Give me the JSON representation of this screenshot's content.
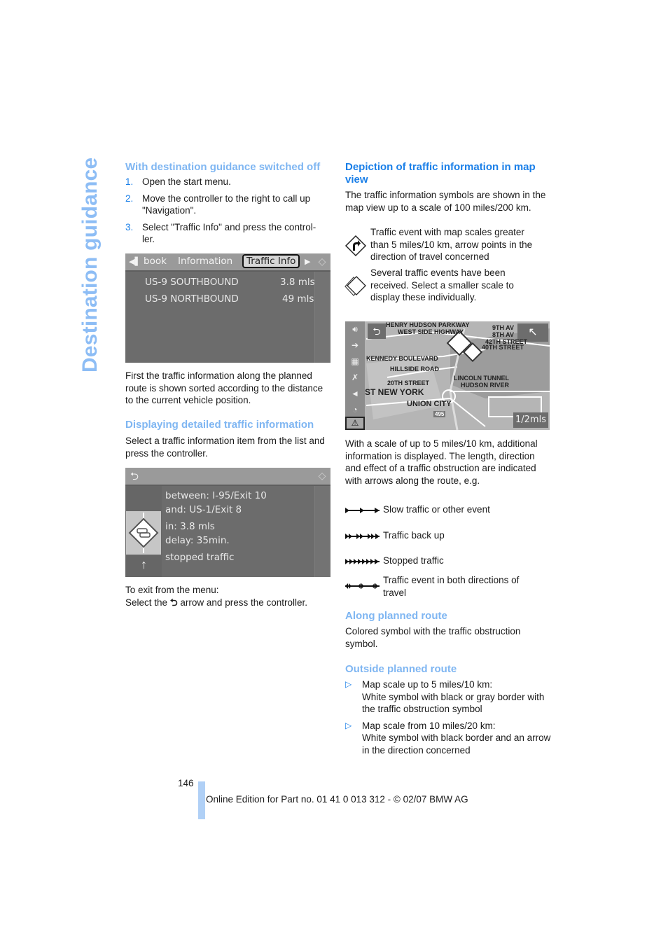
{
  "side_title": "Destination guidance",
  "left_column": {
    "section1": {
      "heading": "With destination guidance switched off",
      "steps": [
        {
          "num": "1.",
          "text": "Open the start menu."
        },
        {
          "num": "2.",
          "text": "Move the controller to the right to call up \"Navigation\"."
        },
        {
          "num": "3.",
          "text": "Select \"Traffic Info\" and press the control-ler."
        }
      ]
    },
    "screen1": {
      "tabs": [
        "book",
        "Information",
        "Traffic Info"
      ],
      "active_tab": "Traffic Info",
      "rows": [
        {
          "road": "US-9 SOUTHBOUND",
          "distance": "3.8 mls"
        },
        {
          "road": "US-9 NORTHBOUND",
          "distance": "49 mls"
        }
      ]
    },
    "para1": "First the traffic information along the planned route is shown sorted according to the distance to the current vehicle position.",
    "section2": {
      "heading": "Displaying detailed traffic information",
      "text": "Select a traffic information item from the list and press the controller."
    },
    "screen2": {
      "lines": [
        "between: I-95/Exit 10",
        "and: US-1/Exit 8",
        "in: 3.8 mls",
        "delay: 35min.",
        "stopped traffic"
      ]
    },
    "exit_text_1": "To exit from the menu:",
    "exit_text_2a": "Select the",
    "exit_text_2b": "arrow and press the controller."
  },
  "right_column": {
    "heading": "Depiction of traffic information in map view",
    "intro": "The traffic information symbols are shown in the map view up to a scale of 100 miles/200 km.",
    "symbols": [
      {
        "icon": "diamond-arrow-icon",
        "text": "Traffic event with map scales greater than 5 miles/10 km, arrow points in the direction of travel concerned"
      },
      {
        "icon": "stacked-diamond-icon",
        "text": "Several traffic events have been received. Select a smaller scale to display these individually."
      }
    ],
    "map": {
      "labels": [
        "HENRY HUDSON PARKWAY",
        "WEST SIDE HIGHWAY",
        "9TH AV",
        "8TH AV",
        "42TH STREET",
        "40TH STREET",
        "KENNEDY BOULEVARD",
        "HILLSIDE ROAD",
        "20TH STREET",
        "LINCOLN TUNNEL",
        "HUDSON RIVER",
        "ST NEW YORK",
        "UNION CITY",
        "495"
      ],
      "scale": "1/2mls"
    },
    "para2": "With a scale of up to 5 miles/10 km, additional information is displayed. The length, direction and effect of a traffic obstruction are indicated with arrows along the route, e.g.",
    "arrows": [
      {
        "icon": "slow-traffic-arrow-icon",
        "text": "Slow traffic or other event"
      },
      {
        "icon": "traffic-backup-arrow-icon",
        "text": "Traffic back up"
      },
      {
        "icon": "stopped-traffic-arrow-icon",
        "text": "Stopped traffic"
      },
      {
        "icon": "both-directions-arrow-icon",
        "text": "Traffic event in both directions of travel"
      }
    ],
    "along": {
      "heading": "Along planned route",
      "text": "Colored symbol with the traffic obstruction symbol."
    },
    "outside": {
      "heading": "Outside planned route",
      "bullets": [
        {
          "line1": "Map scale up to 5 miles/10 km:",
          "line2": "White symbol with black or gray border with the traffic obstruction symbol"
        },
        {
          "line1": "Map scale from 10 miles/20 km:",
          "line2": "White symbol with black border and an arrow in the direction concerned"
        }
      ]
    }
  },
  "footer": {
    "page_number": "146",
    "edition": "Online Edition for Part no. 01 41 0 013 312 - © 02/07 BMW AG"
  },
  "colors": {
    "heading_blue": "#1a7fe8",
    "heading_light_blue": "#7fb6f2",
    "side_title": "#8dbdf5",
    "footer_bar": "#b0d0f6"
  }
}
